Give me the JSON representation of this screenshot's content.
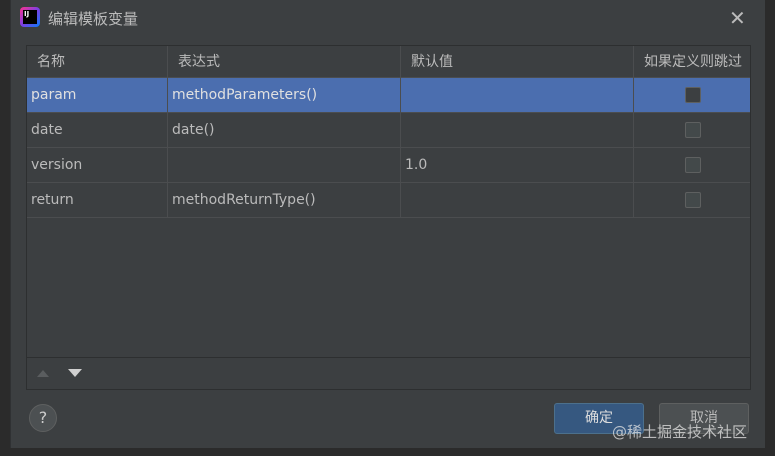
{
  "title": "编辑模板变量",
  "logo_text": "IJ",
  "columns": [
    "名称",
    "表达式",
    "默认值",
    "如果定义则跳过"
  ],
  "rows": [
    {
      "name": "param",
      "expression": "methodParameters()",
      "default": "",
      "skip": false
    },
    {
      "name": "date",
      "expression": "date()",
      "default": "",
      "skip": false
    },
    {
      "name": "version",
      "expression": "",
      "default": "1.0",
      "skip": false
    },
    {
      "name": "return",
      "expression": "methodReturnType()",
      "default": "",
      "skip": false
    }
  ],
  "buttons": {
    "ok": "确定",
    "cancel": "取消",
    "help": "?"
  },
  "watermark": "@稀土掘金技术社区"
}
